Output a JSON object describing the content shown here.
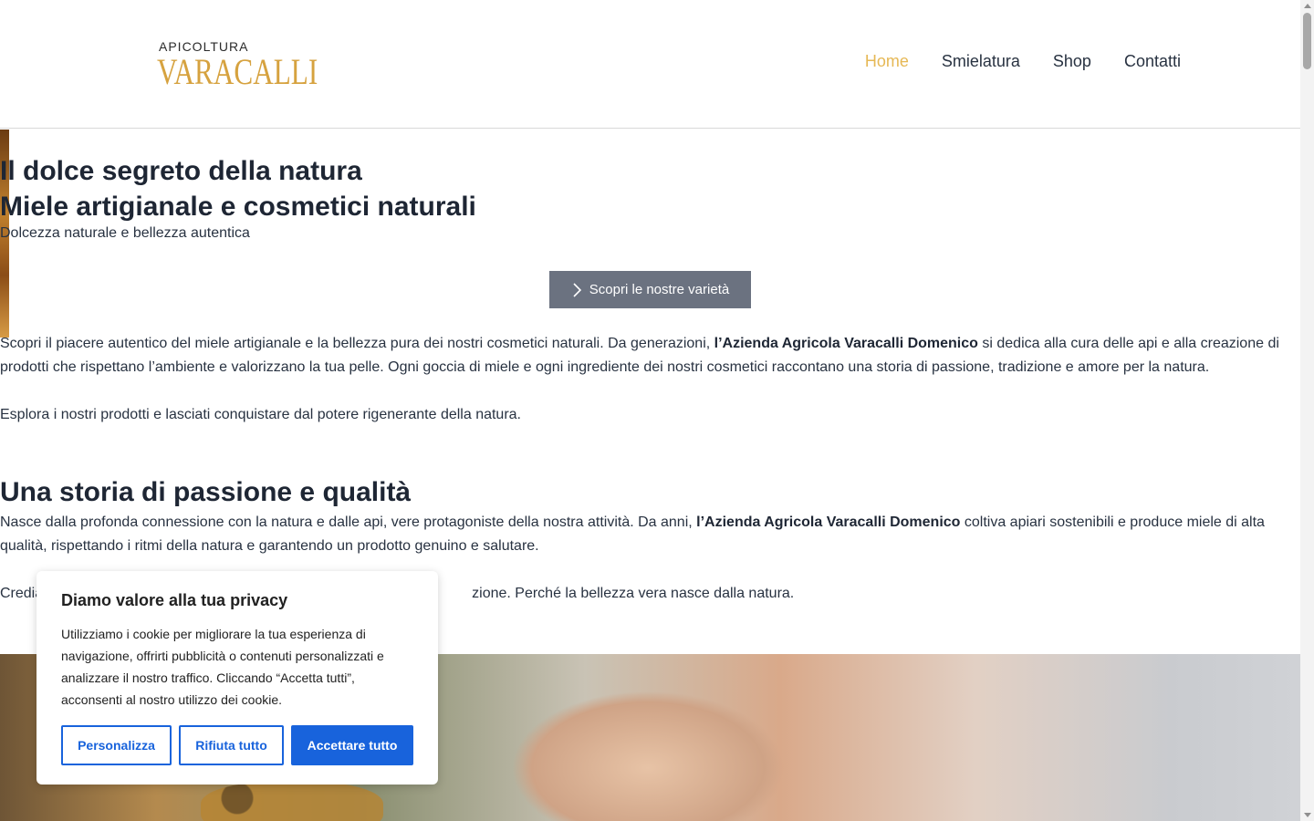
{
  "brand": {
    "top": "APICOLTURA",
    "main": "VARACALLI",
    "color": "#d6a23f"
  },
  "nav": {
    "items": [
      {
        "label": "Home",
        "active": true
      },
      {
        "label": "Smielatura",
        "active": false
      },
      {
        "label": "Shop",
        "active": false
      },
      {
        "label": "Contatti",
        "active": false
      }
    ],
    "active_color": "#e6b855"
  },
  "hero": {
    "title_line1": "Il dolce segreto della natura",
    "title_line2": "Miele artigianale e cosmetici naturali",
    "subtitle": "Dolcezza naturale e bellezza autentica",
    "cta": {
      "label": "Scopri le nostre varietà",
      "icon": "chevron-right-icon"
    }
  },
  "intro": {
    "p1_a": "Scopri il piacere autentico del miele artigianale e la bellezza pura dei nostri cosmetici naturali. Da generazioni, ",
    "p1_b": "l’Azienda Agricola Varacalli Domenico",
    "p1_c": " si dedica alla cura delle api e alla creazione di prodotti che rispettano l’ambiente e valorizzano la tua pelle. Ogni goccia di miele e ogni ingrediente dei nostri cosmetici raccontano una storia di passione, tradizione e amore per la natura.",
    "p2": "Esplora i nostri prodotti e lasciati conquistare dal potere rigenerante della natura."
  },
  "story": {
    "title": "Una storia di passione e qualità",
    "p1_a": "Nasce dalla profonda connessione con la natura e dalle api, vere protagoniste della nostra attività. Da anni, ",
    "p1_b": "l’Azienda Agricola Varacalli Domenico",
    "p1_c": " coltiva apiari sostenibili e produce miele di alta qualità, rispettando i ritmi della natura e garantendo un prodotto genuino e salutare.",
    "p2_visible_start": "Credia",
    "p2_visible_end": "zione. Perché la bellezza vera nasce dalla natura."
  },
  "cookie": {
    "title": "Diamo valore alla tua privacy",
    "text": "Utilizziamo i cookie per migliorare la tua esperienza di navigazione, offrirti pubblicità o contenuti personalizzati e analizzare il nostro traffico. Cliccando “Accetta tutti”, acconsenti al nostro utilizzo dei cookie.",
    "customize": "Personalizza",
    "reject": "Rifiuta tutto",
    "accept": "Accettare tutto",
    "accent": "#1863dc"
  }
}
